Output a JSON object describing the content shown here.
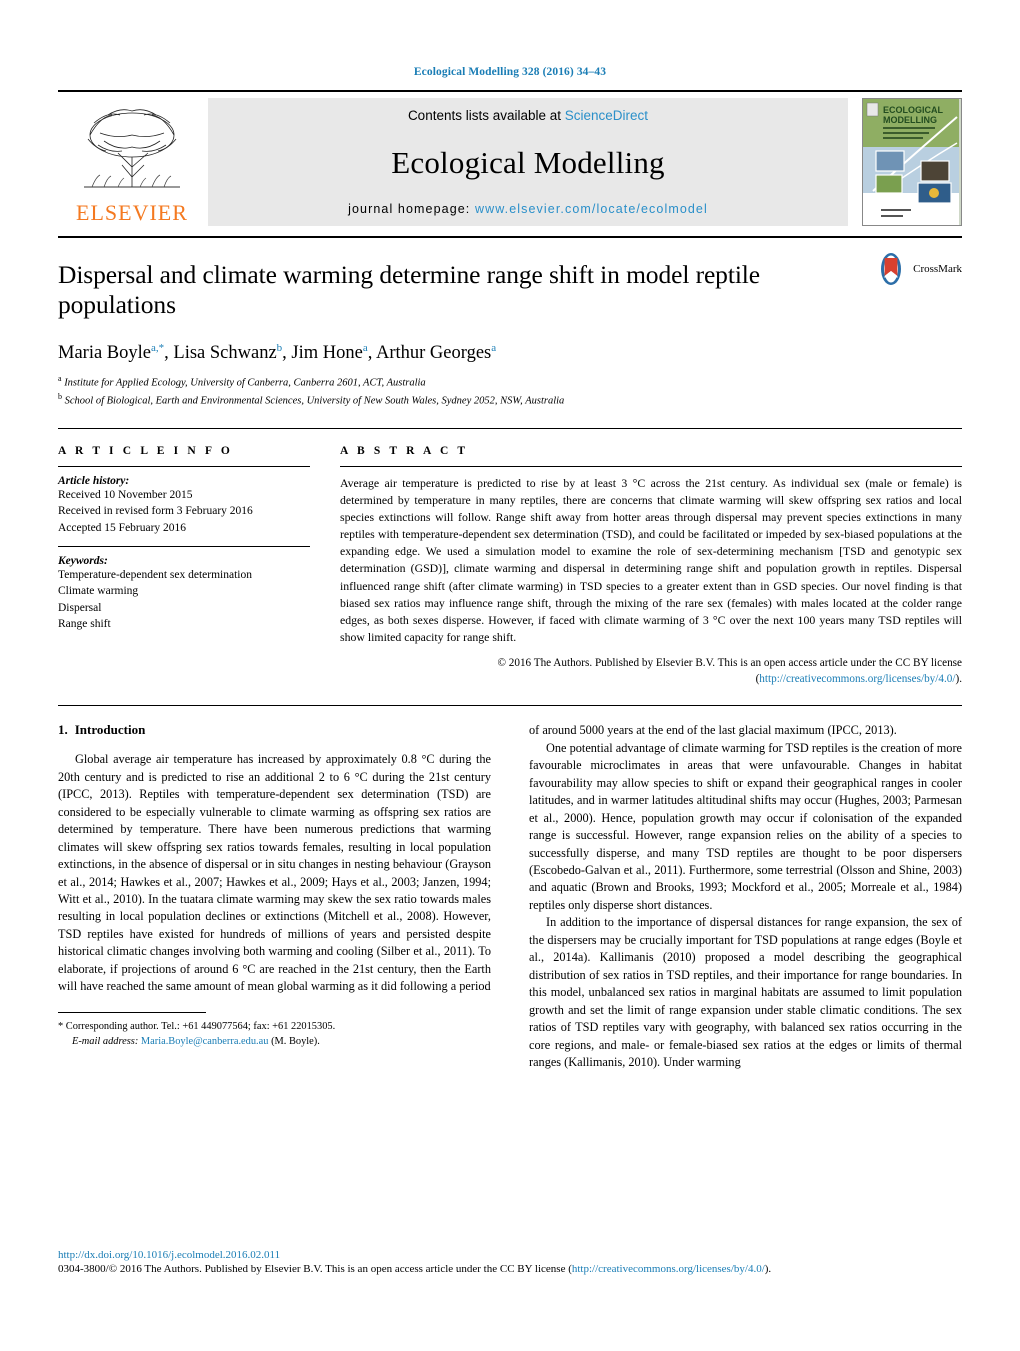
{
  "running_head": "Ecological Modelling 328 (2016) 34–43",
  "masthead": {
    "publisher_name": "ELSEVIER",
    "contents_prefix": "Contents lists available at ",
    "contents_link": "ScienceDirect",
    "journal_title": "Ecological Modelling",
    "homepage_prefix": "journal homepage: ",
    "homepage_url": "www.elsevier.com/locate/ecolmodel",
    "cover_title_line1": "ECOLOGICAL",
    "cover_title_line2": "MODELLING"
  },
  "article": {
    "title": "Dispersal and climate warming determine range shift in model reptile populations",
    "crossmark_label": "CrossMark",
    "authors": [
      {
        "name": "Maria Boyle",
        "marks": "a,*"
      },
      {
        "name": "Lisa Schwanz",
        "marks": "b"
      },
      {
        "name": "Jim Hone",
        "marks": "a"
      },
      {
        "name": "Arthur Georges",
        "marks": "a"
      }
    ],
    "affiliations": [
      {
        "mark": "a",
        "text": "Institute for Applied Ecology, University of Canberra, Canberra 2601, ACT, Australia"
      },
      {
        "mark": "b",
        "text": "School of Biological, Earth and Environmental Sciences, University of New South Wales, Sydney 2052, NSW, Australia"
      }
    ]
  },
  "article_info": {
    "heading": "A R T I C L E   I N F O",
    "history_label": "Article history:",
    "history": [
      "Received 10 November 2015",
      "Received in revised form 3 February 2016",
      "Accepted 15 February 2016"
    ],
    "keywords_label": "Keywords:",
    "keywords": [
      "Temperature-dependent sex determination",
      "Climate warming",
      "Dispersal",
      "Range shift"
    ]
  },
  "abstract": {
    "heading": "A B S T R A C T",
    "text": "Average air temperature is predicted to rise by at least 3 °C across the 21st century. As individual sex (male or female) is determined by temperature in many reptiles, there are concerns that climate warming will skew offspring sex ratios and local species extinctions will follow. Range shift away from hotter areas through dispersal may prevent species extinctions in many reptiles with temperature-dependent sex determination (TSD), and could be facilitated or impeded by sex-biased populations at the expanding edge. We used a simulation model to examine the role of sex-determining mechanism [TSD and genotypic sex determination (GSD)], climate warming and dispersal in determining range shift and population growth in reptiles. Dispersal influenced range shift (after climate warming) in TSD species to a greater extent than in GSD species. Our novel finding is that biased sex ratios may influence range shift, through the mixing of the rare sex (females) with males located at the colder range edges, as both sexes disperse. However, if faced with climate warming of 3 °C over the next 100 years many TSD reptiles will show limited capacity for range shift.",
    "copyright_text": "© 2016 The Authors. Published by Elsevier B.V. This is an open access article under the CC BY license (",
    "copyright_link": "http://creativecommons.org/licenses/by/4.0/",
    "copyright_suffix": ")."
  },
  "body": {
    "section_number": "1.",
    "section_title": "Introduction",
    "left_column": [
      "Global average air temperature has increased by approximately 0.8 °C during the 20th century and is predicted to rise an additional 2 to 6 °C during the 21st century (IPCC, 2013). Reptiles with temperature-dependent sex determination (TSD) are considered to be especially vulnerable to climate warming as offspring sex ratios are determined by temperature. There have been numerous predictions that warming climates will skew offspring sex ratios towards females, resulting in local population extinctions, in the absence of dispersal or in situ changes in nesting behaviour (Grayson et al., 2014; Hawkes et al., 2007; Hawkes et al., 2009; Hays et al., 2003; Janzen, 1994; Witt et al., 2010). In the tuatara climate warming may skew the sex ratio towards males resulting in local population declines or extinctions (Mitchell et al., 2008). However, TSD reptiles have existed for hundreds of millions of years and persisted despite historical climatic changes involving both warming and cooling (Silber et al., 2011). To elaborate, if projections of around 6 °C are reached in the 21st century, then the Earth will have reached the same amount of mean global warming as it did following a period"
    ],
    "right_column": [
      "of around 5000 years at the end of the last glacial maximum (IPCC, 2013).",
      "One potential advantage of climate warming for TSD reptiles is the creation of more favourable microclimates in areas that were unfavourable. Changes in habitat favourability may allow species to shift or expand their geographical ranges in cooler latitudes, and in warmer latitudes altitudinal shifts may occur (Hughes, 2003; Parmesan et al., 2000). Hence, population growth may occur if colonisation of the expanded range is successful. However, range expansion relies on the ability of a species to successfully disperse, and many TSD reptiles are thought to be poor dispersers (Escobedo-Galvan et al., 2011). Furthermore, some terrestrial (Olsson and Shine, 2003) and aquatic (Brown and Brooks, 1993; Mockford et al., 2005; Morreale et al., 1984) reptiles only disperse short distances.",
      "In addition to the importance of dispersal distances for range expansion, the sex of the dispersers may be crucially important for TSD populations at range edges (Boyle et al., 2014a). Kallimanis (2010) proposed a model describing the geographical distribution of sex ratios in TSD reptiles, and their importance for range boundaries. In this model, unbalanced sex ratios in marginal habitats are assumed to limit population growth and set the limit of range expansion under stable climatic conditions. The sex ratios of TSD reptiles vary with geography, with balanced sex ratios occurring in the core regions, and male- or female-biased sex ratios at the edges or limits of thermal ranges (Kallimanis, 2010). Under warming"
    ]
  },
  "footnote": {
    "corresponding": "* Corresponding author. Tel.: +61 449077564; fax: +61 22015305.",
    "email_label": "E-mail address:",
    "email": "Maria.Boyle@canberra.edu.au",
    "email_suffix": "(M. Boyle)."
  },
  "footer": {
    "doi": "http://dx.doi.org/10.1016/j.ecolmodel.2016.02.011",
    "issn_line": "0304-3800/© 2016 The Authors. Published by Elsevier B.V. This is an open access article under the CC BY license (",
    "issn_link": "http://creativecommons.org/licenses/by/4.0/",
    "issn_suffix": ")."
  },
  "colors": {
    "link": "#1a7db5",
    "elsevier_orange": "#F47920",
    "band_grey": "#e8e8e8"
  }
}
